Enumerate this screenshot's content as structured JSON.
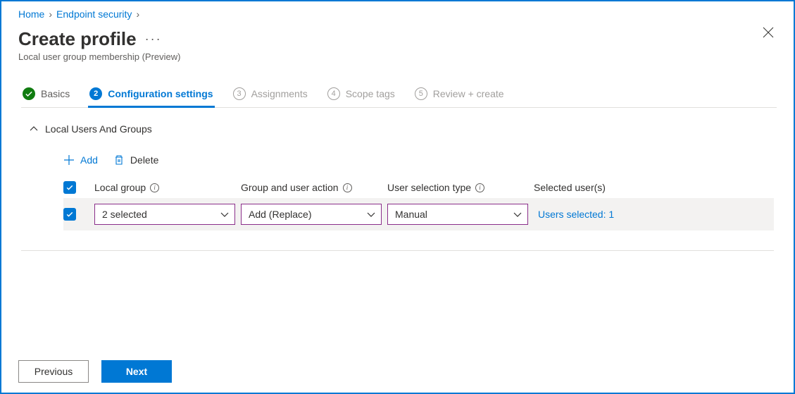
{
  "breadcrumb": {
    "home": "Home",
    "endpoint": "Endpoint security"
  },
  "page": {
    "title": "Create profile",
    "subtitle": "Local user group membership (Preview)"
  },
  "tabs": {
    "basics": "Basics",
    "config_num": "2",
    "config": "Configuration settings",
    "assign_num": "3",
    "assignments": "Assignments",
    "scope_num": "4",
    "scope": "Scope tags",
    "review_num": "5",
    "review": "Review + create"
  },
  "section": {
    "title": "Local Users And Groups"
  },
  "toolbar": {
    "add": "Add",
    "delete": "Delete"
  },
  "columns": {
    "local_group": "Local group",
    "group_action": "Group and user action",
    "selection_type": "User selection type",
    "selected_users": "Selected user(s)"
  },
  "row": {
    "local_group_value": "2 selected",
    "action_value": "Add (Replace)",
    "selection_value": "Manual",
    "users_link": "Users selected: 1"
  },
  "footer": {
    "previous": "Previous",
    "next": "Next"
  }
}
